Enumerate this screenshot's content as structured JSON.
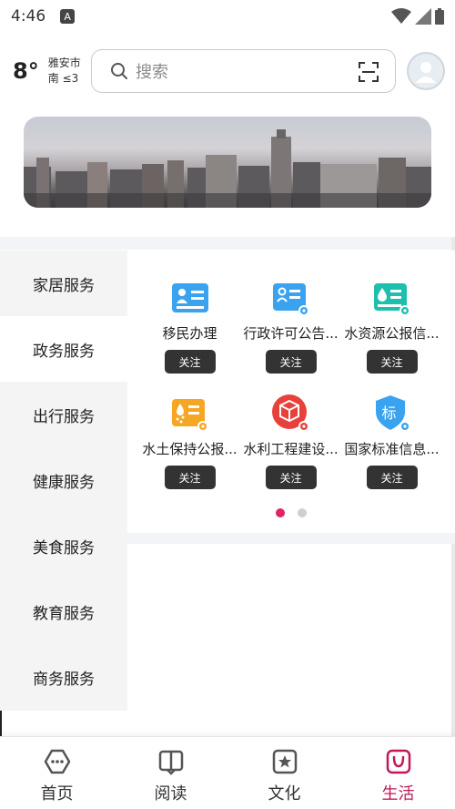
{
  "status_bar": {
    "time": "4:46",
    "a_badge": "A"
  },
  "header": {
    "temperature": "8°",
    "city": "雅安市",
    "wind": "南 ≤3",
    "search_placeholder": "搜索"
  },
  "sidebar": {
    "items": [
      {
        "label": "家居服务",
        "active": false
      },
      {
        "label": "政务服务",
        "active": true
      },
      {
        "label": "出行服务",
        "active": false
      },
      {
        "label": "健康服务",
        "active": false
      },
      {
        "label": "美食服务",
        "active": false
      },
      {
        "label": "教育服务",
        "active": false
      },
      {
        "label": "商务服务",
        "active": false
      }
    ]
  },
  "services": [
    {
      "label": "移民办理",
      "button": "关注",
      "icon": "id-card-icon",
      "color": "#3aa3f0"
    },
    {
      "label": "行政许可公告...",
      "button": "关注",
      "icon": "license-icon",
      "color": "#3aa3f0"
    },
    {
      "label": "水资源公报信...",
      "button": "关注",
      "icon": "water-drop-icon",
      "color": "#1fbfae"
    },
    {
      "label": "水土保持公报...",
      "button": "关注",
      "icon": "soil-icon",
      "color": "#f5a623"
    },
    {
      "label": "水利工程建设...",
      "button": "关注",
      "icon": "cube-icon",
      "color": "#e8413b"
    },
    {
      "label": "国家标准信息...",
      "button": "关注",
      "icon": "shield-standard-icon",
      "color": "#3aa3f0",
      "badge": "标"
    }
  ],
  "pager": {
    "pages": 2,
    "current": 1,
    "active_color": "#e0245e"
  },
  "bottom_nav": [
    {
      "label": "首页",
      "icon": "home-icon",
      "active": false
    },
    {
      "label": "阅读",
      "icon": "book-icon",
      "active": false
    },
    {
      "label": "文化",
      "icon": "star-badge-icon",
      "active": false
    },
    {
      "label": "生活",
      "icon": "bag-icon",
      "active": true
    }
  ],
  "colors": {
    "accent": "#c2185b",
    "button_bg": "#333333"
  }
}
